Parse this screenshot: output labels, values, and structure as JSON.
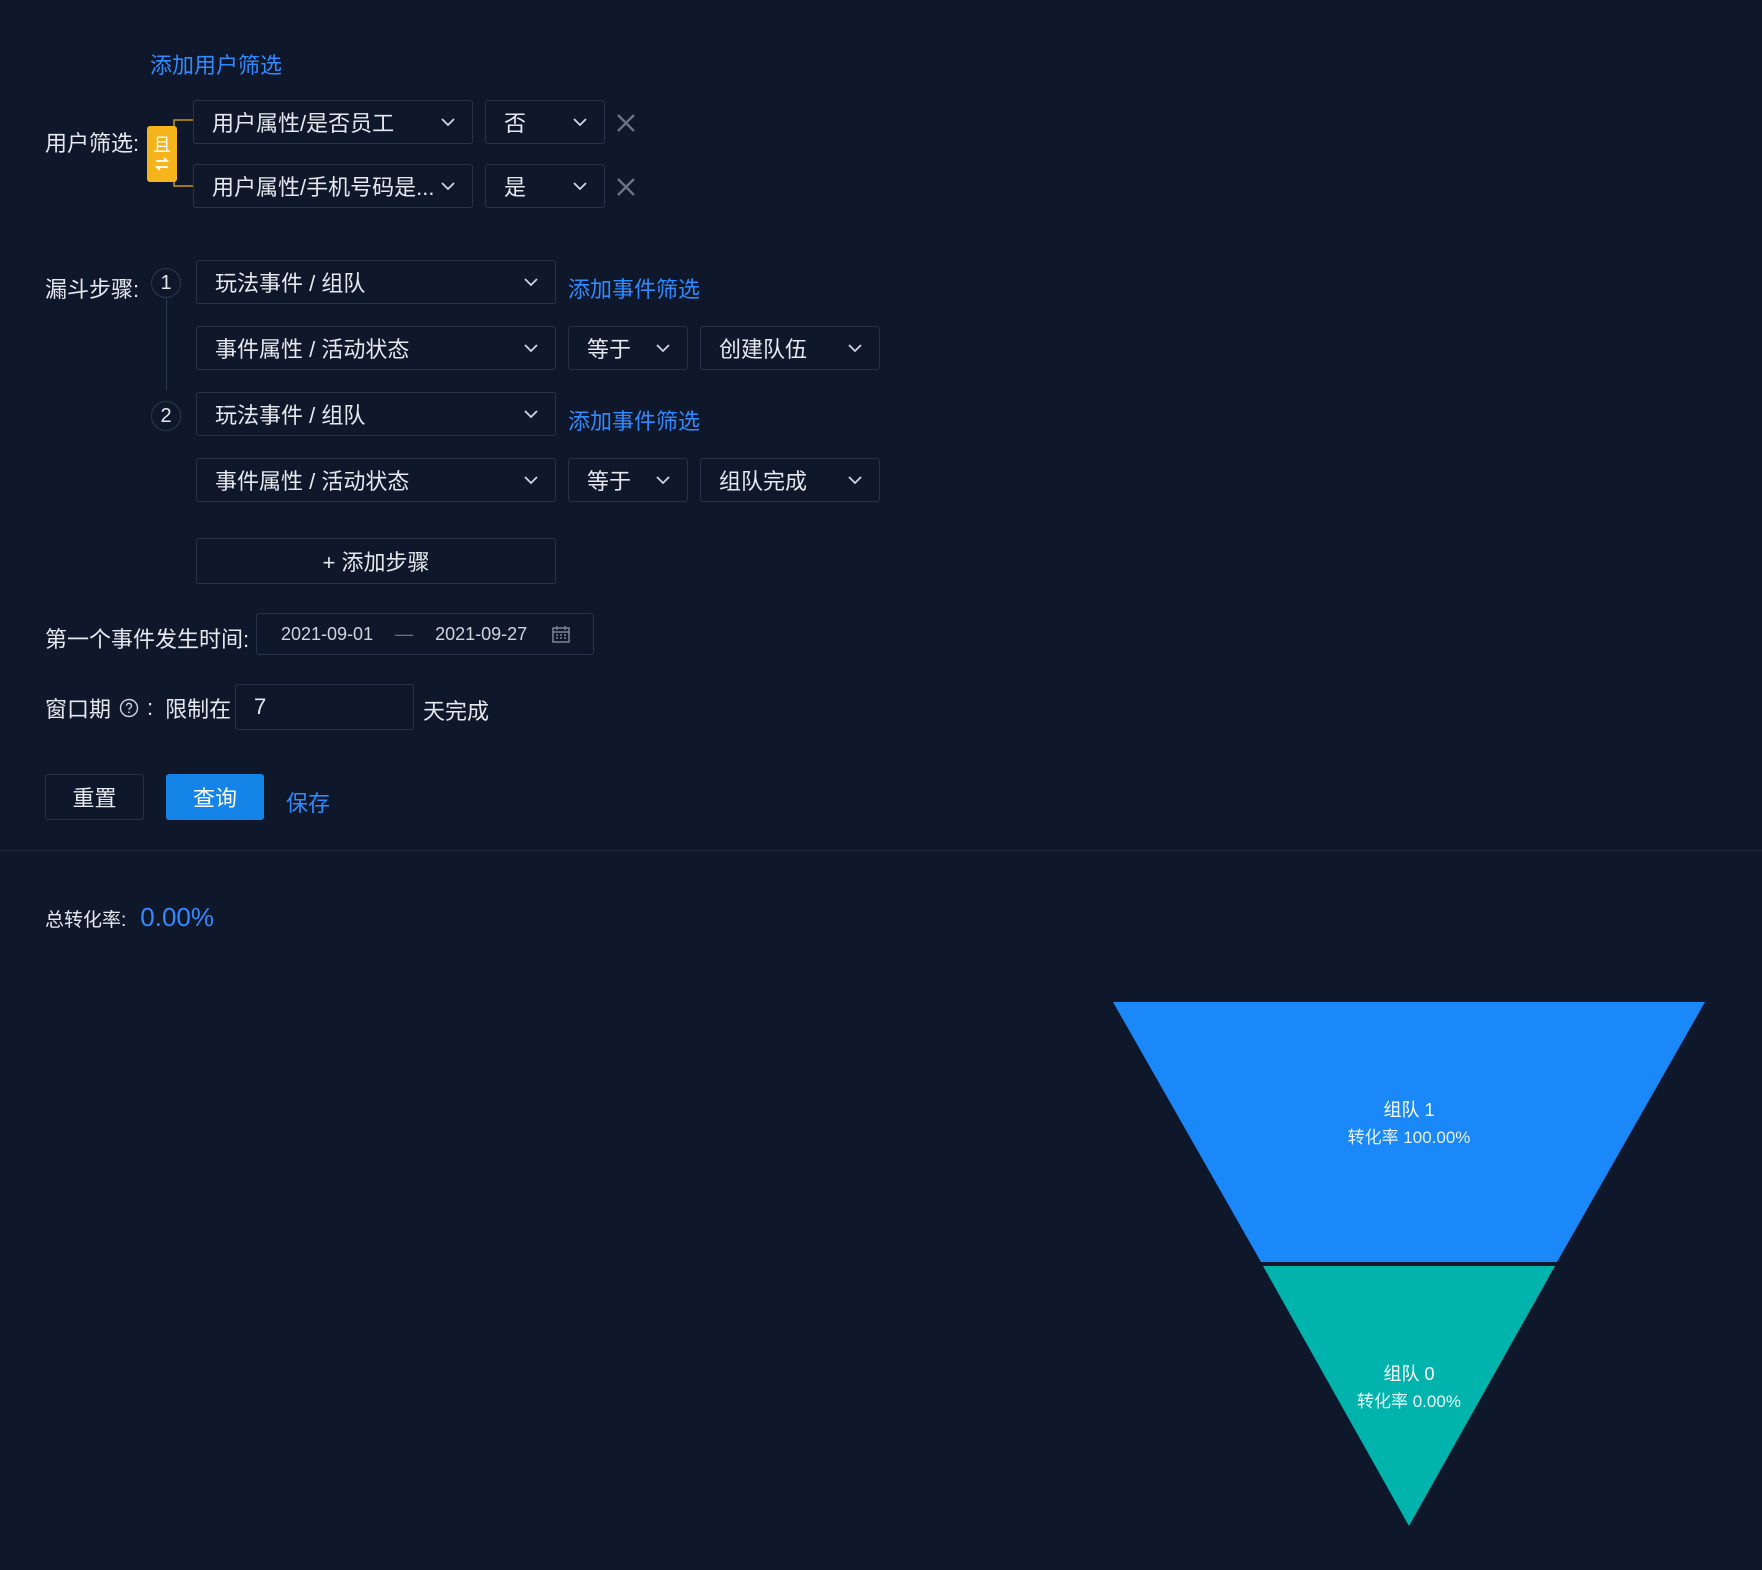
{
  "filters": {
    "add_user_filter": "添加用户筛选",
    "label": "用户筛选:",
    "logic_badge": "且",
    "rows": [
      {
        "property": "用户属性/是否员工",
        "value": "否"
      },
      {
        "property": "用户属性/手机号码是...",
        "value": "是"
      }
    ]
  },
  "funnel": {
    "label": "漏斗步骤:",
    "add_event_filter": "添加事件筛选",
    "steps": [
      {
        "number": "1",
        "event": "玩法事件 / 组队",
        "attr": "事件属性 / 活动状态",
        "op": "等于",
        "value": "创建队伍"
      },
      {
        "number": "2",
        "event": "玩法事件 / 组队",
        "attr": "事件属性 / 活动状态",
        "op": "等于",
        "value": "组队完成"
      }
    ],
    "add_step": "+ 添加步骤"
  },
  "time": {
    "label": "第一个事件发生时间:",
    "start": "2021-09-01",
    "separator": "—",
    "end": "2021-09-27"
  },
  "window": {
    "label": "窗口期",
    "colon": ":",
    "limit_label": "限制在",
    "days_value": "7",
    "suffix": "天完成"
  },
  "actions": {
    "reset": "重置",
    "query": "查询",
    "save": "保存"
  },
  "result": {
    "total_label": "总转化率:",
    "total_value": "0.00%"
  },
  "colors": {
    "accent": "#2f8bff",
    "funnel_top": "#1a88f8",
    "funnel_bottom": "#00b3ad",
    "badge": "#f5b31c"
  },
  "chart_data": {
    "type": "funnel",
    "stages": [
      {
        "name": "组队",
        "count": "1",
        "rate_label": "转化率 100.00%",
        "color": "#1a88f8"
      },
      {
        "name": "组队",
        "count": "0",
        "rate_label": "转化率 0.00%",
        "color": "#00b3ad"
      }
    ]
  }
}
